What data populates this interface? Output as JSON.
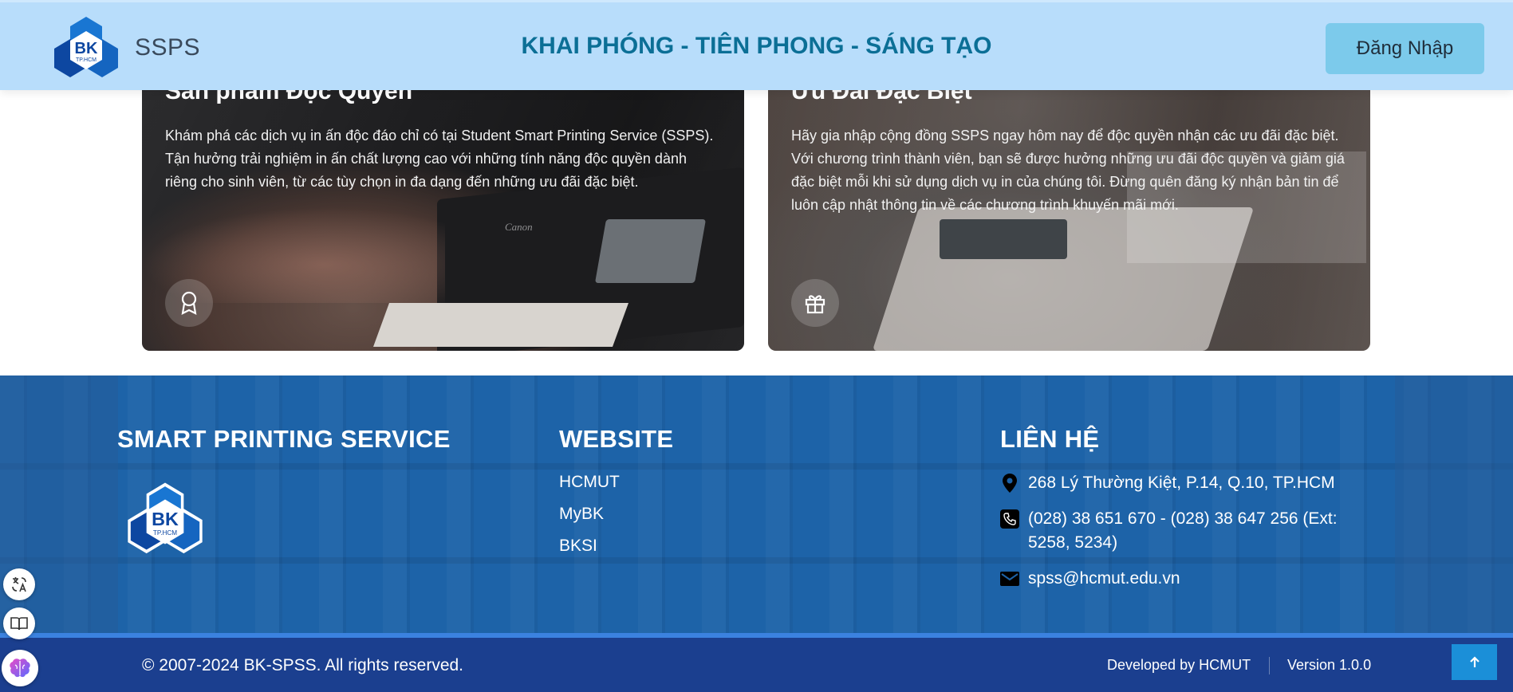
{
  "header": {
    "brand": "SSPS",
    "slogan": "KHAI PHÓNG - TIÊN PHONG - SÁNG TẠO",
    "login_label": "Đăng Nhập",
    "logo_text": "BK",
    "logo_subtext": "TP.HCM"
  },
  "cards": [
    {
      "title": "Sản phẩm Độc Quyền",
      "text": "Khám phá các dịch vụ in ấn độc đáo chỉ có tại Student Smart Printing Service (SSPS). Tận hưởng trải nghiệm in ấn chất lượng cao với những tính năng độc quyền dành riêng cho sinh viên, từ các tùy chọn in đa dạng đến những ưu đãi đặc biệt.",
      "icon": "award-icon",
      "printer_label": "Canon"
    },
    {
      "title": "Ưu Đãi Đặc Biệt",
      "text": "Hãy gia nhập cộng đồng SSPS ngay hôm nay để độc quyền nhận các ưu đãi đặc biệt. Với chương trình thành viên, bạn sẽ được hưởng những ưu đãi độc quyền và giảm giá đặc biệt mỗi khi sử dụng dịch vụ in của chúng tôi. Đừng quên đăng ký nhận bản tin để luôn cập nhật thông tin về các chương trình khuyến mãi mới.",
      "icon": "gift-icon"
    }
  ],
  "footer": {
    "col1_title": "SMART PRINTING SERVICE",
    "col2_title": "WEBSITE",
    "col3_title": "LIÊN HỆ",
    "links": [
      "HCMUT",
      "MyBK",
      "BKSI"
    ],
    "contact": {
      "address": "268 Lý Thường Kiệt, P.14, Q.10, TP.HCM",
      "phone": "(028) 38 651 670 - (028) 38 647 256 (Ext: 5258, 5234)",
      "email": "spss@hcmut.edu.vn"
    },
    "copyright": "© 2007-2024 BK-SPSS. All rights reserved.",
    "developed_by": "Developed by HCMUT",
    "version": "Version 1.0.0"
  },
  "colors": {
    "header_bg": "#b8ddfb",
    "slogan": "#0b6f96",
    "login_bg": "#7ccaeb",
    "footer_bg": "#1d63a8",
    "footer_bottom": "#1b3f8f",
    "logo_blue": "#1565c0"
  },
  "floating_tools": [
    "translate-icon",
    "book-icon",
    "brain-icon"
  ]
}
